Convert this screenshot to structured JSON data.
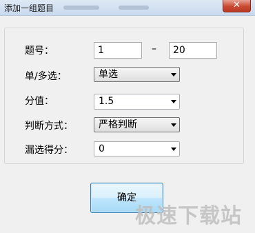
{
  "window": {
    "title": "添加一组题目",
    "close_glyph": "✕"
  },
  "form": {
    "question_number_label": "题号：",
    "question_from": "1",
    "range_separator": "–",
    "question_to": "20",
    "choice_type_label": "单/多选：",
    "choice_type_value": "单选",
    "score_label": "分值：",
    "score_value": "1.5",
    "judge_mode_label": "判断方式：",
    "judge_mode_value": "严格判断",
    "missed_score_label": "漏选得分：",
    "missed_score_value": "0"
  },
  "buttons": {
    "ok_label": "确定"
  },
  "watermark": {
    "text": "极速下载站"
  }
}
